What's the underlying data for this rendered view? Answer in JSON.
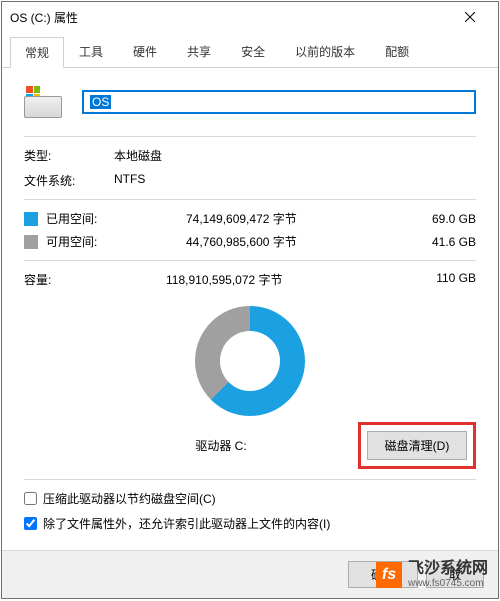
{
  "window": {
    "title": "OS (C:) 属性"
  },
  "tabs": [
    "常规",
    "工具",
    "硬件",
    "共享",
    "安全",
    "以前的版本",
    "配额"
  ],
  "active_tab": 0,
  "drive": {
    "name": "OS",
    "type_label": "类型:",
    "type_value": "本地磁盘",
    "fs_label": "文件系统:",
    "fs_value": "NTFS",
    "used_label": "已用空间:",
    "used_bytes": "74,149,609,472 字节",
    "used_gb": "69.0 GB",
    "free_label": "可用空间:",
    "free_bytes": "44,760,985,600 字节",
    "free_gb": "41.6 GB",
    "capacity_label": "容量:",
    "capacity_bytes": "118,910,595,072 字节",
    "capacity_gb": "110 GB",
    "drive_label": "驱动器 C:",
    "cleanup_label": "磁盘清理(D)"
  },
  "checkboxes": {
    "compress": "压缩此驱动器以节约磁盘空间(C)",
    "index": "除了文件属性外，还允许索引此驱动器上文件的内容(I)"
  },
  "footer": {
    "ok": "确定",
    "cancel": "取"
  },
  "watermark": {
    "name": "飞沙系统网",
    "url": "www.fs0745.com"
  },
  "chart_data": {
    "type": "pie",
    "title": "驱动器 C:",
    "series": [
      {
        "name": "已用空间",
        "value": 69.0,
        "color": "#1ba1e2"
      },
      {
        "name": "可用空间",
        "value": 41.6,
        "color": "#a0a0a0"
      }
    ],
    "unit": "GB",
    "total": 110
  }
}
